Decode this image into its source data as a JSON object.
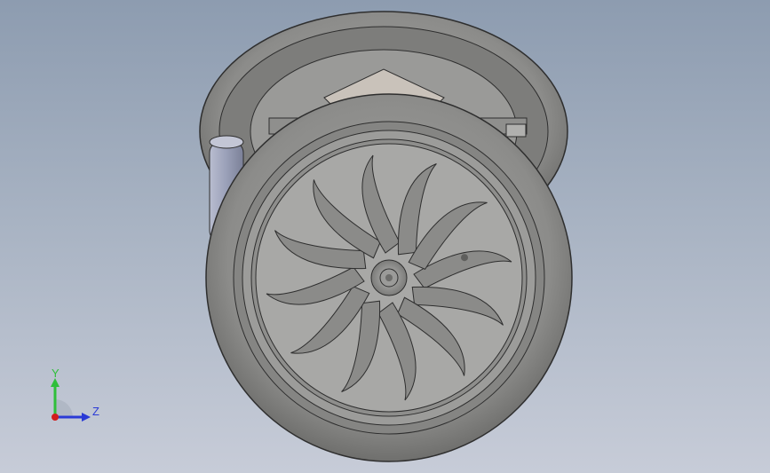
{
  "viewport": {
    "background_top": "#8d9cb0",
    "background_bottom": "#c7ccd8"
  },
  "model": {
    "description_icon": "wheel-assembly-model",
    "tire_color": "#8a8a88",
    "tire_edge": "#2e2e2e",
    "bracket_color": "#c9c2ba",
    "spoke_count": 12
  },
  "triad": {
    "y_label": "Y",
    "z_label": "Z",
    "y_color": "#2fbf3a",
    "z_color": "#2a3ad6",
    "x_color": "#d21d1d"
  }
}
